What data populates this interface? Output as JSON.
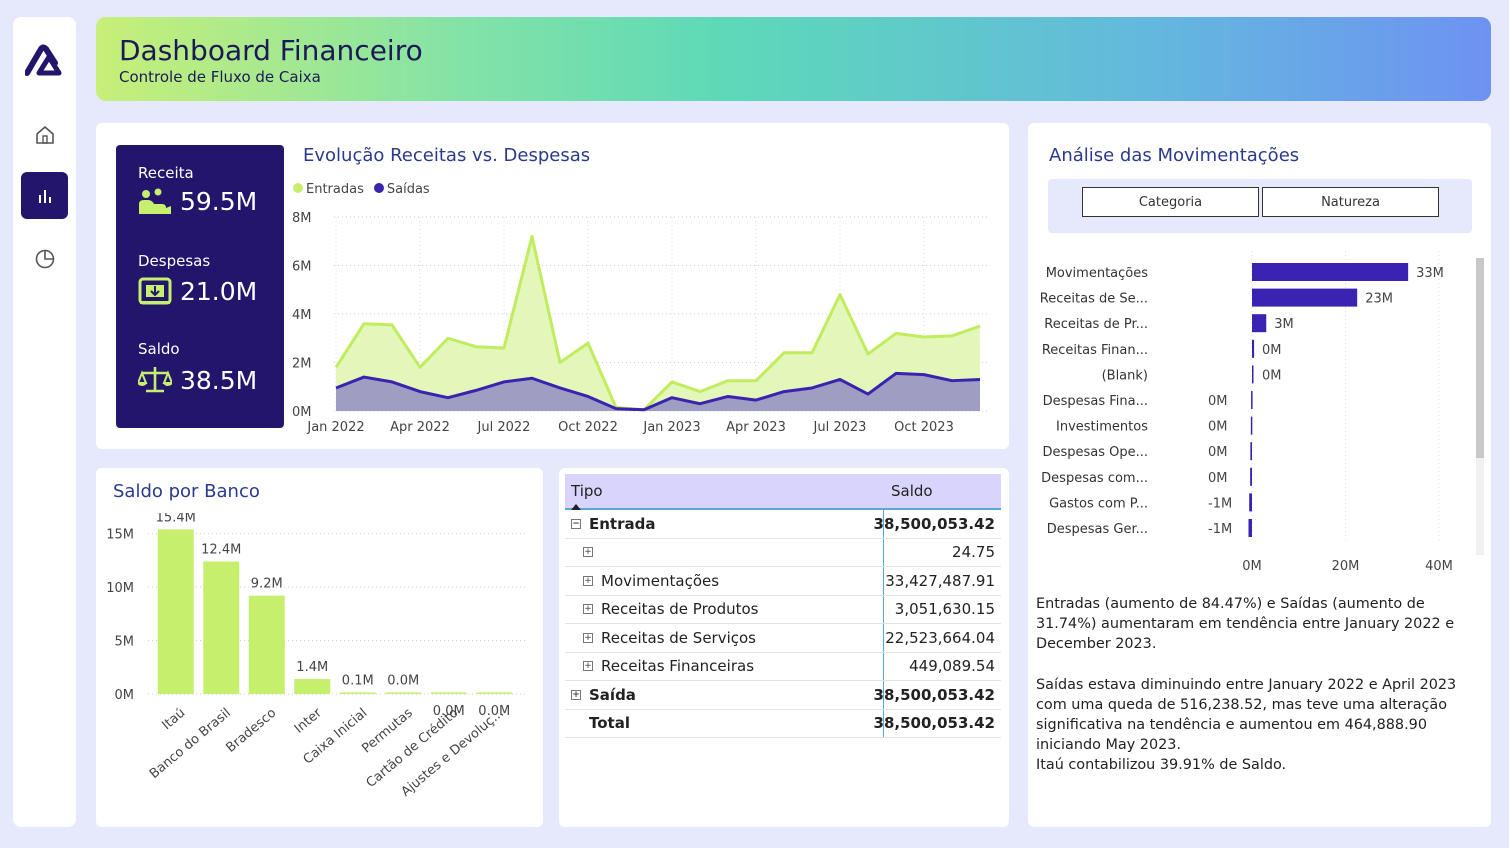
{
  "header": {
    "title": "Dashboard Financeiro",
    "subtitle": "Controle de Fluxo de Caixa"
  },
  "nav": {
    "items": [
      {
        "name": "home-icon",
        "active": false
      },
      {
        "name": "bar-chart-icon",
        "active": true
      },
      {
        "name": "pie-chart-icon",
        "active": false
      }
    ]
  },
  "kpi": {
    "receita_label": "Receita",
    "receita_value": "59.5M",
    "despesas_label": "Despesas",
    "despesas_value": "21.0M",
    "saldo_label": "Saldo",
    "saldo_value": "38.5M"
  },
  "evolution": {
    "title": "Evolução Receitas vs. Despesas",
    "legend": [
      "Entradas",
      "Saídas"
    ]
  },
  "movimentacoes": {
    "title": "Análise das Movimentações",
    "buttons": [
      "Categoria",
      "Natureza"
    ]
  },
  "saldo_banco": {
    "title": "Saldo por Banco"
  },
  "table": {
    "headers": [
      "Tipo",
      "Saldo"
    ],
    "rows": [
      {
        "label": "Entrada",
        "value": "38,500,053.42",
        "bold": true,
        "expander": "−",
        "indent": false
      },
      {
        "label": "",
        "value": "24.75",
        "bold": false,
        "expander": "+",
        "indent": true
      },
      {
        "label": "Movimentações",
        "value": "33,427,487.91",
        "bold": false,
        "expander": "+",
        "indent": true
      },
      {
        "label": "Receitas de Produtos",
        "value": "3,051,630.15",
        "bold": false,
        "expander": "+",
        "indent": true
      },
      {
        "label": "Receitas de Serviços",
        "value": "22,523,664.04",
        "bold": false,
        "expander": "+",
        "indent": true
      },
      {
        "label": "Receitas Financeiras",
        "value": "449,089.54",
        "bold": false,
        "expander": "+",
        "indent": true
      },
      {
        "label": "Saída",
        "value": "38,500,053.42",
        "bold": true,
        "expander": "+",
        "indent": false
      },
      {
        "label": "Total",
        "value": "38,500,053.42",
        "bold": true,
        "expander": "",
        "indent": false
      }
    ]
  },
  "narrative": {
    "p1": "Entradas (aumento de 84.47%) e Saídas (aumento de 31.74%) aumentaram em tendência entre January 2022 e December 2023.",
    "p2": "Saídas estava diminuindo entre January 2022 e April 2023 com uma queda de 516,238.52, mas teve uma alteração significativa na tendência e aumentou em 464,888.90 iniciando May 2023.",
    "p3": "Itaú contabilizou 39.91% de Saldo."
  },
  "colors": {
    "navy": "#22156b",
    "lime": "#c6ef6e",
    "lime_line": "#b3e84a",
    "purple": "#3a23b0",
    "title": "#2b3a8c"
  },
  "chart_data": [
    {
      "type": "area",
      "title": "Evolução Receitas vs. Despesas",
      "x": [
        "Jan 2022",
        "Feb 2022",
        "Mar 2022",
        "Apr 2022",
        "May 2022",
        "Jun 2022",
        "Jul 2022",
        "Aug 2022",
        "Sep 2022",
        "Oct 2022",
        "Nov 2022",
        "Dec 2022",
        "Jan 2023",
        "Feb 2023",
        "Mar 2023",
        "Apr 2023",
        "May 2023",
        "Jun 2023",
        "Jul 2023",
        "Aug 2023",
        "Sep 2023",
        "Oct 2023",
        "Nov 2023",
        "Dec 2023"
      ],
      "x_tick_labels": [
        "Jan 2022",
        "Apr 2022",
        "Jul 2022",
        "Oct 2022",
        "Jan 2023",
        "Apr 2023",
        "Jul 2023",
        "Oct 2023"
      ],
      "y_tick_labels": [
        "0M",
        "2M",
        "4M",
        "6M",
        "8M"
      ],
      "ylim": [
        0,
        8
      ],
      "series": [
        {
          "name": "Entradas",
          "values": [
            1.8,
            3.6,
            3.55,
            1.8,
            3.0,
            2.65,
            2.6,
            7.2,
            2.0,
            2.8,
            0.15,
            0.05,
            1.2,
            0.8,
            1.25,
            1.25,
            2.4,
            2.4,
            4.8,
            2.35,
            3.2,
            3.05,
            3.1,
            3.5
          ]
        },
        {
          "name": "Saídas",
          "values": [
            0.95,
            1.4,
            1.2,
            0.8,
            0.55,
            0.85,
            1.2,
            1.35,
            0.95,
            0.6,
            0.1,
            0.05,
            0.55,
            0.3,
            0.6,
            0.45,
            0.8,
            0.95,
            1.3,
            0.7,
            1.55,
            1.5,
            1.25,
            1.3
          ]
        }
      ],
      "grid": true,
      "legend": "top-left"
    },
    {
      "type": "bar",
      "orientation": "horizontal",
      "title": "Análise das Movimentações",
      "categories": [
        "Movimentações",
        "Receitas de Se...",
        "Receitas de Pr...",
        "Receitas Finan...",
        "(Blank)",
        "Despesas Fina...",
        "Investimentos",
        "Despesas Ope...",
        "Despesas com...",
        "Gastos com P...",
        "Despesas Ger..."
      ],
      "values": [
        33.4,
        22.5,
        3.05,
        0.45,
        0.0,
        -0.2,
        -0.25,
        -0.35,
        -0.4,
        -0.6,
        -0.75
      ],
      "data_labels": [
        "33M",
        "23M",
        "3M",
        "0M",
        "0M",
        "0M",
        "0M",
        "0M",
        "0M",
        "-1M",
        "-1M"
      ],
      "x_tick_labels": [
        "0M",
        "20M",
        "40M"
      ],
      "xlim": [
        0,
        40
      ]
    },
    {
      "type": "bar",
      "title": "Saldo por Banco",
      "categories": [
        "Itaú",
        "Banco do Brasil",
        "Bradesco",
        "Inter",
        "Caixa Inicial",
        "Permutas",
        "Cartão de Crédito",
        "Ajustes e Devoluç..."
      ],
      "values": [
        15.4,
        12.4,
        9.2,
        1.4,
        0.1,
        0.0,
        0.0,
        0.0
      ],
      "data_labels": [
        "15.4M",
        "12.4M",
        "9.2M",
        "1.4M",
        "0.1M",
        "0.0M",
        "0.0M",
        "0.0M"
      ],
      "y_tick_labels": [
        "0M",
        "5M",
        "10M",
        "15M"
      ],
      "ylim": [
        0,
        16
      ]
    }
  ]
}
